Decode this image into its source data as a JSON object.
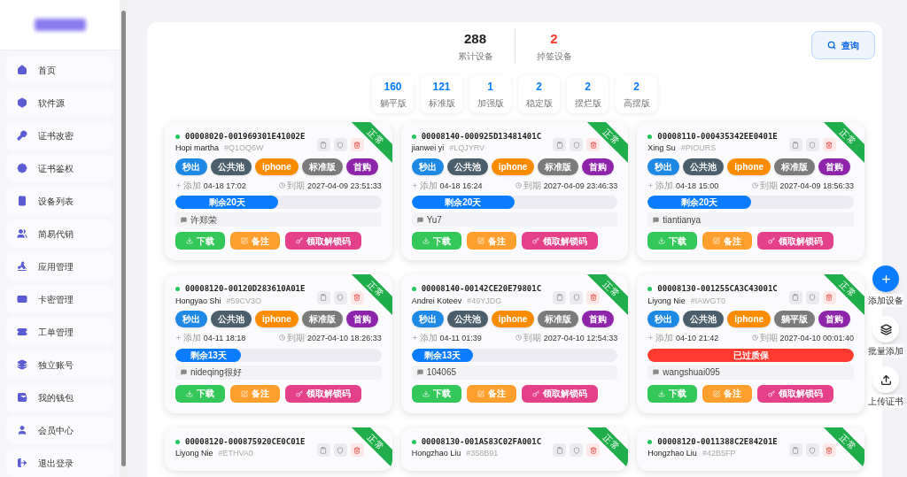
{
  "sidebar": {
    "items": [
      {
        "label": "首页"
      },
      {
        "label": "软件源"
      },
      {
        "label": "证书改密"
      },
      {
        "label": "证书鉴权"
      },
      {
        "label": "设备列表"
      },
      {
        "label": "简易代销"
      },
      {
        "label": "应用管理"
      },
      {
        "label": "卡密管理"
      },
      {
        "label": "工单管理"
      },
      {
        "label": "独立账号"
      },
      {
        "label": "我的钱包"
      },
      {
        "label": "会员中心"
      },
      {
        "label": "退出登录"
      }
    ]
  },
  "summary": [
    {
      "value": "288",
      "label": "累计设备",
      "kind": "normal"
    },
    {
      "value": "2",
      "label": "掉签设备",
      "kind": "alert"
    }
  ],
  "query_button": "查询",
  "editions": [
    {
      "value": "160",
      "label": "躺平版"
    },
    {
      "value": "121",
      "label": "标准版"
    },
    {
      "value": "1",
      "label": "加强版"
    },
    {
      "value": "2",
      "label": "稳定版"
    },
    {
      "value": "2",
      "label": "摆烂版"
    },
    {
      "value": "2",
      "label": "高摆版"
    }
  ],
  "devices": [
    {
      "id": "00008020-001969301E41002E",
      "name": "Hopi martha",
      "code": "#Q1OQ6W",
      "ribbon": "正常",
      "tags": [
        {
          "label": "秒出",
          "kind": "blue"
        },
        {
          "label": "公共池",
          "kind": "slate"
        },
        {
          "label": "iphone",
          "kind": "orange"
        },
        {
          "label": "标准版",
          "kind": "gray"
        },
        {
          "label": "首购",
          "kind": "purple"
        }
      ],
      "added_label": "添加",
      "added": "04-18 17:02",
      "expire_label": "到期",
      "expire": "2027-04-09 23:51:33",
      "kind": "active",
      "level": 0.5,
      "remaining": "剩余20天",
      "note": "许郑荣",
      "actions": [
        {
          "label": "下载",
          "kind": "download"
        },
        {
          "label": "备注",
          "kind": "note"
        },
        {
          "label": "领取解锁码",
          "kind": "unlock"
        }
      ]
    },
    {
      "id": "00008140-000925D13481401C",
      "name": "jianwei yi",
      "code": "#LQJYRV",
      "ribbon": "正常",
      "tags": [
        {
          "label": "秒出",
          "kind": "blue"
        },
        {
          "label": "公共池",
          "kind": "slate"
        },
        {
          "label": "iphone",
          "kind": "orange"
        },
        {
          "label": "标准版",
          "kind": "gray"
        },
        {
          "label": "首购",
          "kind": "purple"
        }
      ],
      "added_label": "添加",
      "added": "04-18 16:24",
      "expire_label": "到期",
      "expire": "2027-04-09 23:46:33",
      "kind": "active",
      "level": 0.5,
      "remaining": "剩余20天",
      "note": "Yu7",
      "actions": [
        {
          "label": "下载",
          "kind": "download"
        },
        {
          "label": "备注",
          "kind": "note"
        },
        {
          "label": "领取解锁码",
          "kind": "unlock"
        }
      ]
    },
    {
      "id": "00008110-000435342EE0401E",
      "name": "Xing Su",
      "code": "#PIOURS",
      "ribbon": "正常",
      "tags": [
        {
          "label": "秒出",
          "kind": "blue"
        },
        {
          "label": "公共池",
          "kind": "slate"
        },
        {
          "label": "iphone",
          "kind": "orange"
        },
        {
          "label": "标准版",
          "kind": "gray"
        },
        {
          "label": "首购",
          "kind": "purple"
        }
      ],
      "added_label": "添加",
      "added": "04-18 15:00",
      "expire_label": "到期",
      "expire": "2027-04-09 18:56:33",
      "kind": "active",
      "level": 0.5,
      "remaining": "剩余20天",
      "note": "tiantianya",
      "actions": [
        {
          "label": "下载",
          "kind": "download"
        },
        {
          "label": "备注",
          "kind": "note"
        },
        {
          "label": "领取解锁码",
          "kind": "unlock"
        }
      ]
    },
    {
      "id": "00008120-00120D283610A01E",
      "name": "Hongyao Shi",
      "code": "#59CV3O",
      "ribbon": "正常",
      "tags": [
        {
          "label": "秒出",
          "kind": "blue"
        },
        {
          "label": "公共池",
          "kind": "slate"
        },
        {
          "label": "iphone",
          "kind": "orange"
        },
        {
          "label": "标准版",
          "kind": "gray"
        },
        {
          "label": "首购",
          "kind": "purple"
        }
      ],
      "added_label": "添加",
      "added": "04-11 18:18",
      "expire_label": "到期",
      "expire": "2027-04-10 18:26:33",
      "kind": "active",
      "level": 0.32,
      "remaining": "剩余13天",
      "note": "nideqing很好",
      "actions": [
        {
          "label": "下载",
          "kind": "download"
        },
        {
          "label": "备注",
          "kind": "note"
        },
        {
          "label": "领取解锁码",
          "kind": "unlock"
        }
      ]
    },
    {
      "id": "00008140-00142CE20E79801C",
      "name": "Andrei Koteev",
      "code": "#49YJDG",
      "ribbon": "正常",
      "tags": [
        {
          "label": "秒出",
          "kind": "blue"
        },
        {
          "label": "公共池",
          "kind": "slate"
        },
        {
          "label": "iphone",
          "kind": "orange"
        },
        {
          "label": "标准版",
          "kind": "gray"
        },
        {
          "label": "首购",
          "kind": "purple"
        }
      ],
      "added_label": "添加",
      "added": "04-11 01:39",
      "expire_label": "到期",
      "expire": "2027-04-10 12:54:33",
      "kind": "active",
      "level": 0.3,
      "remaining": "剩余13天",
      "note": "104065",
      "actions": [
        {
          "label": "下载",
          "kind": "download"
        },
        {
          "label": "备注",
          "kind": "note"
        },
        {
          "label": "领取解锁码",
          "kind": "unlock"
        }
      ]
    },
    {
      "id": "00008130-001255CA3C43001C",
      "name": "Liyong Nie",
      "code": "#IAWGT0",
      "ribbon": "正常",
      "tags": [
        {
          "label": "秒出",
          "kind": "blue"
        },
        {
          "label": "公共池",
          "kind": "slate"
        },
        {
          "label": "iphone",
          "kind": "orange"
        },
        {
          "label": "躺平版",
          "kind": "gray"
        },
        {
          "label": "首购",
          "kind": "purple"
        }
      ],
      "added_label": "添加",
      "added": "04-10 21:42",
      "expire_label": "到期",
      "expire": "2027-04-10 00:01:40",
      "kind": "expired",
      "level": 1,
      "remaining": "已过质保",
      "note": "wangshuai095",
      "actions": [
        {
          "label": "下载",
          "kind": "download"
        },
        {
          "label": "备注",
          "kind": "note"
        },
        {
          "label": "领取解锁码",
          "kind": "unlock"
        }
      ]
    },
    {
      "id": "00008120-000875920CE0C01E",
      "name": "Liyong Nie",
      "code": "#ETHVA0",
      "ribbon": "正常"
    },
    {
      "id": "00008130-001A583C02FA001C",
      "name": "Hongzhao Liu",
      "code": "#358B91",
      "ribbon": "正常"
    },
    {
      "id": "00008120-0011388C2E84201E",
      "name": "Hongzhao Liu",
      "code": "#42B5FP",
      "ribbon": "正常"
    }
  ],
  "float_actions": [
    {
      "label": "添加设备",
      "kind": "add"
    },
    {
      "label": "批量添加",
      "kind": "batch"
    },
    {
      "label": "上传证书",
      "kind": "upload"
    }
  ]
}
